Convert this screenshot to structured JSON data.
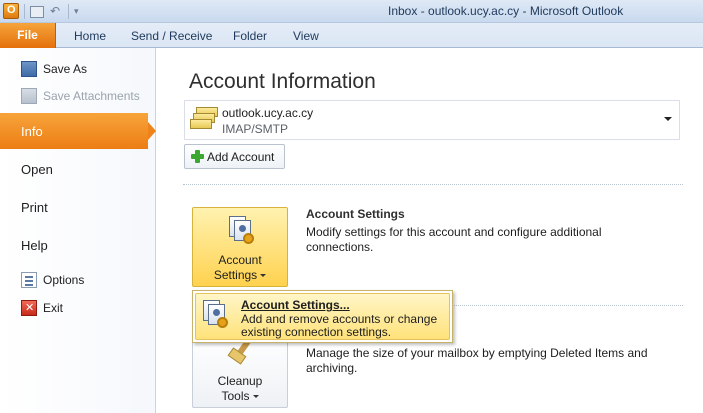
{
  "window": {
    "title": "Inbox - outlook.ucy.ac.cy  -  Microsoft Outlook"
  },
  "ribbon": {
    "file_tab": "File",
    "tabs": [
      "Home",
      "Send / Receive",
      "Folder",
      "View"
    ]
  },
  "nav": {
    "save_as": "Save As",
    "save_attachments": "Save Attachments",
    "info": "Info",
    "open": "Open",
    "print": "Print",
    "help": "Help",
    "options": "Options",
    "exit": "Exit"
  },
  "main": {
    "title": "Account Information",
    "account": {
      "name": "outlook.ucy.ac.cy",
      "type": "IMAP/SMTP"
    },
    "add_account": "Add Account",
    "account_settings_button": [
      "Account",
      "Settings"
    ],
    "account_settings_title": "Account Settings",
    "account_settings_desc": "Modify settings for this account and configure additional connections.",
    "cleanup_button": [
      "Cleanup",
      "Tools"
    ],
    "cleanup_desc": "Manage the size of your mailbox by emptying Deleted Items and archiving."
  },
  "popup": {
    "title": "Account Settings...",
    "desc": "Add and remove accounts or change existing connection settings."
  },
  "colors": {
    "accent": "#ec7d14",
    "highlight": "#ffe27a"
  }
}
